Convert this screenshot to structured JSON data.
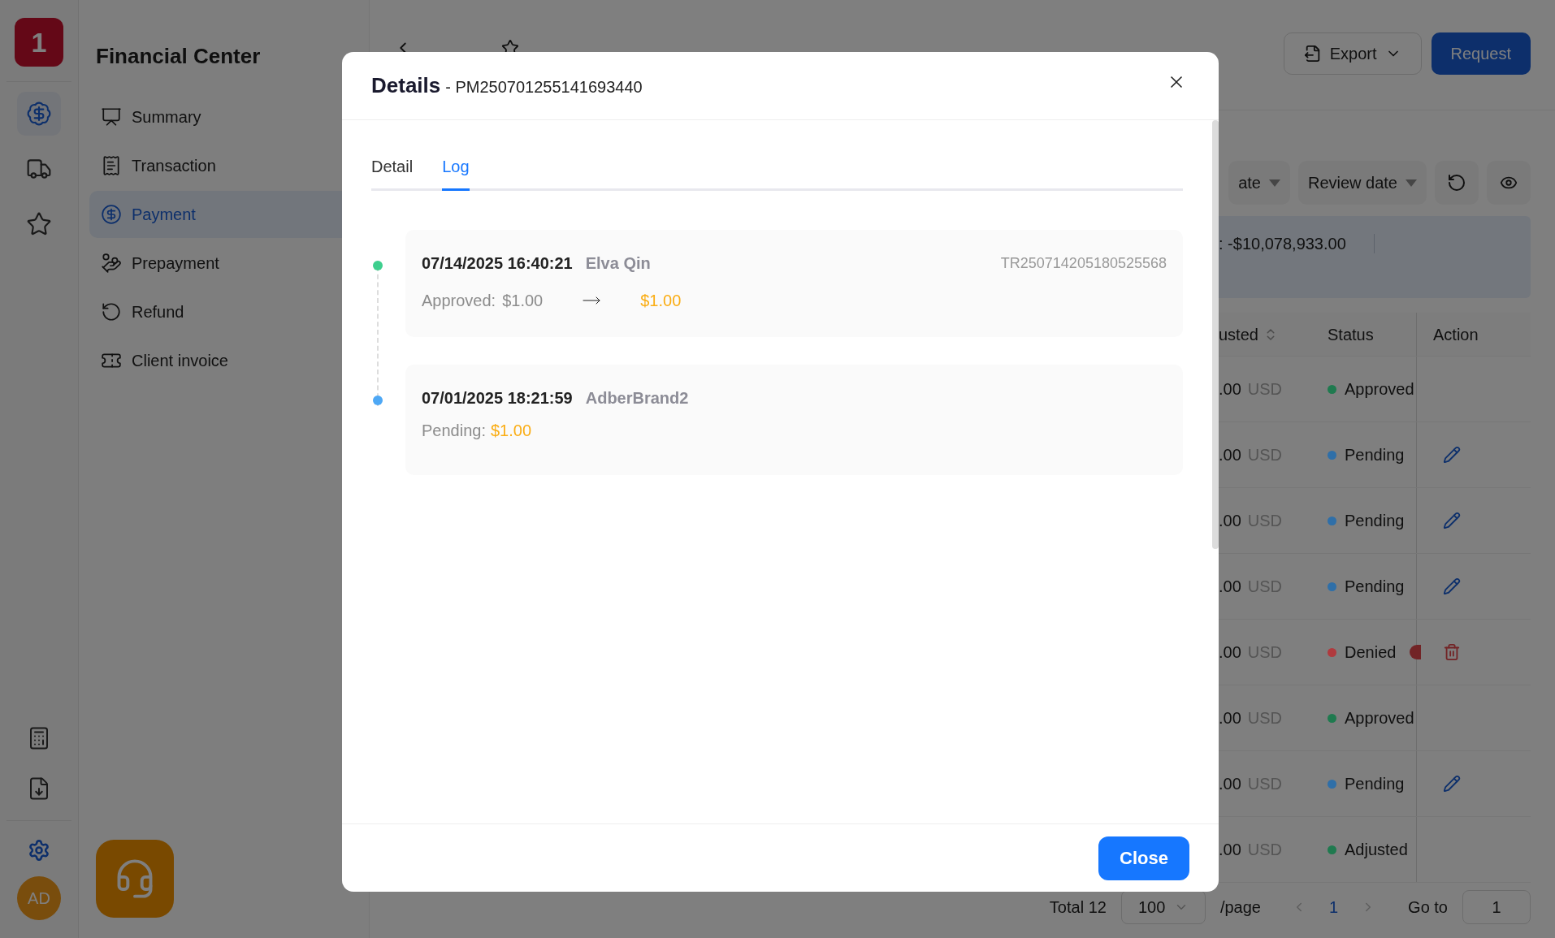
{
  "rail": {
    "logo": "1",
    "items": [
      {
        "selected": true
      },
      {
        "selected": false
      },
      {
        "selected": false
      }
    ],
    "avatar": "AD"
  },
  "sidebar": {
    "title": "Financial Center",
    "items": [
      {
        "label": "Summary",
        "selected": false
      },
      {
        "label": "Transaction",
        "selected": false
      },
      {
        "label": "Payment",
        "selected": true
      },
      {
        "label": "Prepayment",
        "selected": false
      },
      {
        "label": "Refund",
        "selected": false
      },
      {
        "label": "Client invoice",
        "selected": false
      }
    ]
  },
  "page": {
    "export": "Export",
    "request": "Request",
    "filters": [
      "ate",
      "Review date"
    ],
    "summary": ": -$10,078,933.00",
    "columns": [
      {
        "label": "usted",
        "sortable": true
      },
      {
        "label": "Status",
        "sortable": false
      },
      {
        "label": "Action",
        "sortable": false
      }
    ],
    "rows": [
      {
        "amount": ".00",
        "currency": "USD",
        "status": "Approved",
        "color": "#1f7a4f",
        "kind": "none",
        "alert": false
      },
      {
        "amount": ".00",
        "currency": "USD",
        "status": "Pending",
        "color": "#2f6fa8",
        "kind": "edit",
        "alert": false
      },
      {
        "amount": ".00",
        "currency": "USD",
        "status": "Pending",
        "color": "#2f6fa8",
        "kind": "edit",
        "alert": false
      },
      {
        "amount": ".00",
        "currency": "USD",
        "status": "Pending",
        "color": "#2f6fa8",
        "kind": "edit",
        "alert": false
      },
      {
        "amount": ".00",
        "currency": "USD",
        "status": "Denied",
        "color": "#b03a3e",
        "kind": "delete",
        "alert": true
      },
      {
        "amount": ".00",
        "currency": "USD",
        "status": "Approved",
        "color": "#1f7a4f",
        "kind": "none",
        "alert": false
      },
      {
        "amount": ".00",
        "currency": "USD",
        "status": "Pending",
        "color": "#2f6fa8",
        "kind": "edit",
        "alert": false
      },
      {
        "amount": ".00",
        "currency": "USD",
        "status": "Adjusted",
        "color": "#1f7a4f",
        "kind": "none",
        "alert": false
      }
    ],
    "pagination": {
      "total": "Total 12",
      "page_size": "100",
      "per_page": "/page",
      "current": "1",
      "goto_label": "Go to",
      "goto_value": "1"
    }
  },
  "modal": {
    "title": "Details",
    "subtitle": "- PM250701255141693440",
    "tabs": [
      {
        "label": "Detail",
        "selected": false
      },
      {
        "label": "Log",
        "selected": true
      }
    ],
    "entries": [
      {
        "kind": "change",
        "color": "#3ecf8e",
        "time": "07/14/2025 16:40:21",
        "user": "Elva Qin",
        "ref": "TR250714205180525568",
        "label": "Approved:",
        "from": "$1.00",
        "to": "$1.00"
      },
      {
        "kind": "status",
        "color": "#4ea8f5",
        "time": "07/01/2025 18:21:59",
        "user": "AdberBrand2",
        "label": "Pending:",
        "to": "$1.00"
      }
    ],
    "close": "Close"
  }
}
